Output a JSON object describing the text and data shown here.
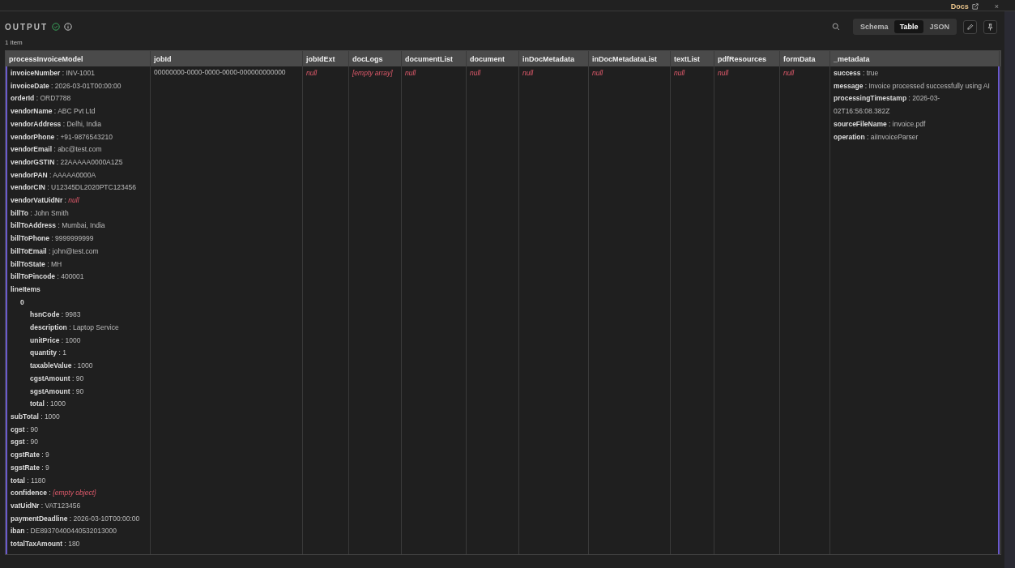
{
  "topbar": {
    "link": "Docs",
    "close": "×"
  },
  "output": {
    "title": "OUTPUT",
    "count": "1 item"
  },
  "views": [
    {
      "label": "Schema",
      "selected": false
    },
    {
      "label": "Table",
      "selected": true
    },
    {
      "label": "JSON",
      "selected": false
    }
  ],
  "table": {
    "separator": ":",
    "columns": [
      "processInvoiceModel",
      "jobId",
      "jobIdExt",
      "docLogs",
      "documentList",
      "document",
      "inDocMetadata",
      "inDocMetadataList",
      "textList",
      "pdfResources",
      "formData",
      "_metadata"
    ],
    "cells": [
      {
        "kind": "fields",
        "fields": [
          {
            "key": "invoiceNumber",
            "value": "INV-1001",
            "empty": false
          },
          {
            "key": "invoiceDate",
            "value": "2026-03-01T00:00:00",
            "empty": false
          },
          {
            "key": "orderId",
            "value": "ORD7788",
            "empty": false
          },
          {
            "key": "vendorName",
            "value": "ABC Pvt Ltd",
            "empty": false
          },
          {
            "key": "vendorAddress",
            "value": "Delhi, India",
            "empty": false
          },
          {
            "key": "vendorPhone",
            "value": "+91-9876543210",
            "empty": false
          },
          {
            "key": "vendorEmail",
            "value": "abc@test.com",
            "empty": false
          },
          {
            "key": "vendorGSTIN",
            "value": "22AAAAA0000A1Z5",
            "empty": false
          },
          {
            "key": "vendorPAN",
            "value": "AAAAA0000A",
            "empty": false
          },
          {
            "key": "vendorCIN",
            "value": "U12345DL2020PTC123456",
            "empty": false
          },
          {
            "key": "vendorVatUidNr",
            "value": "null",
            "empty": true
          },
          {
            "key": "billTo",
            "value": "John Smith",
            "empty": false
          },
          {
            "key": "billToAddress",
            "value": "Mumbai, India",
            "empty": false
          },
          {
            "key": "billToPhone",
            "value": "9999999999",
            "empty": false
          },
          {
            "key": "billToEmail",
            "value": "john@test.com",
            "empty": false
          },
          {
            "key": "billToState",
            "value": "MH",
            "empty": false
          },
          {
            "key": "billToPincode",
            "value": "400001",
            "empty": false
          },
          {
            "key": "lineItems",
            "children": [
              {
                "key": "0",
                "children": [
                  {
                    "key": "hsnCode",
                    "value": "9983",
                    "empty": false
                  },
                  {
                    "key": "description",
                    "value": "Laptop Service",
                    "empty": false
                  },
                  {
                    "key": "unitPrice",
                    "value": "1000",
                    "empty": false
                  },
                  {
                    "key": "quantity",
                    "value": "1",
                    "empty": false
                  },
                  {
                    "key": "taxableValue",
                    "value": "1000",
                    "empty": false
                  },
                  {
                    "key": "cgstAmount",
                    "value": "90",
                    "empty": false
                  },
                  {
                    "key": "sgstAmount",
                    "value": "90",
                    "empty": false
                  },
                  {
                    "key": "total",
                    "value": "1000",
                    "empty": false
                  }
                ]
              }
            ]
          },
          {
            "key": "subTotal",
            "value": "1000",
            "empty": false
          },
          {
            "key": "cgst",
            "value": "90",
            "empty": false
          },
          {
            "key": "sgst",
            "value": "90",
            "empty": false
          },
          {
            "key": "cgstRate",
            "value": "9",
            "empty": false
          },
          {
            "key": "sgstRate",
            "value": "9",
            "empty": false
          },
          {
            "key": "total",
            "value": "1180",
            "empty": false
          },
          {
            "key": "confidence",
            "value": "{empty object}",
            "empty": true
          },
          {
            "key": "vatUidNr",
            "value": "VAT123456",
            "empty": false
          },
          {
            "key": "paymentDeadline",
            "value": "2026-03-10T00:00:00",
            "empty": false
          },
          {
            "key": "iban",
            "value": "DE89370400440532013000",
            "empty": false
          },
          {
            "key": "totalTaxAmount",
            "value": "180",
            "empty": false
          }
        ]
      },
      {
        "kind": "text",
        "text": "00000000-0000-0000-0000-000000000000"
      },
      {
        "kind": "empty",
        "text": "null"
      },
      {
        "kind": "empty",
        "text": "[empty array]"
      },
      {
        "kind": "empty",
        "text": "null"
      },
      {
        "kind": "empty",
        "text": "null"
      },
      {
        "kind": "empty",
        "text": "null"
      },
      {
        "kind": "empty",
        "text": "null"
      },
      {
        "kind": "empty",
        "text": "null"
      },
      {
        "kind": "empty",
        "text": "null"
      },
      {
        "kind": "empty",
        "text": "null"
      },
      {
        "kind": "fields",
        "fields": [
          {
            "key": "success",
            "value": "true",
            "empty": false
          },
          {
            "key": "message",
            "value": "Invoice processed successfully using AI",
            "empty": false
          },
          {
            "key": "processingTimestamp",
            "value": "2026-03-02T16:56:08.382Z",
            "empty": false
          },
          {
            "key": "sourceFileName",
            "value": "invoice.pdf",
            "empty": false
          },
          {
            "key": "operation",
            "value": "aiInvoiceParser",
            "empty": false
          }
        ]
      }
    ]
  }
}
